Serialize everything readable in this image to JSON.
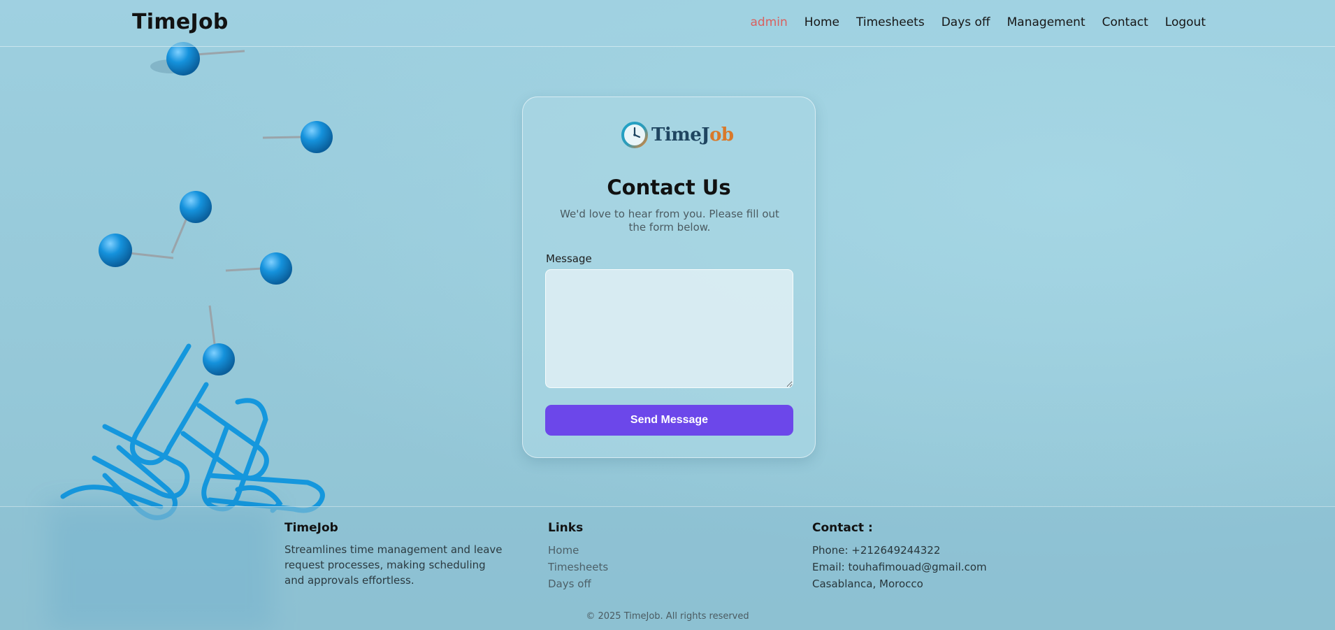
{
  "header": {
    "brand": "TimeJob",
    "nav": [
      "admin",
      "Home",
      "Timesheets",
      "Days off",
      "Management",
      "Contact",
      "Logout"
    ],
    "active_item": "admin"
  },
  "card": {
    "logo_text_main": "TimeJ",
    "logo_text_accent": "ob",
    "title": "Contact Us",
    "subtitle": "We'd love to hear from you. Please fill out the form below.",
    "message_label": "Message",
    "message_value": "",
    "button_label": "Send Message"
  },
  "footer": {
    "about": {
      "title": "TimeJob",
      "text": "Streamlines time management and leave request processes, making scheduling and approvals effortless."
    },
    "links": {
      "title": "Links",
      "items": [
        "Home",
        "Timesheets",
        "Days off"
      ]
    },
    "contact": {
      "title": "Contact :",
      "phone": "Phone: +212649244322",
      "email": "Email: touhafimouad@gmail.com",
      "address": "Casablanca, Morocco"
    },
    "copyright": "© 2025 TimeJob. All rights reserved"
  },
  "colors": {
    "accent_button": "#6c47ea",
    "active_nav": "#d9605e",
    "background": "#9ecfdd"
  }
}
